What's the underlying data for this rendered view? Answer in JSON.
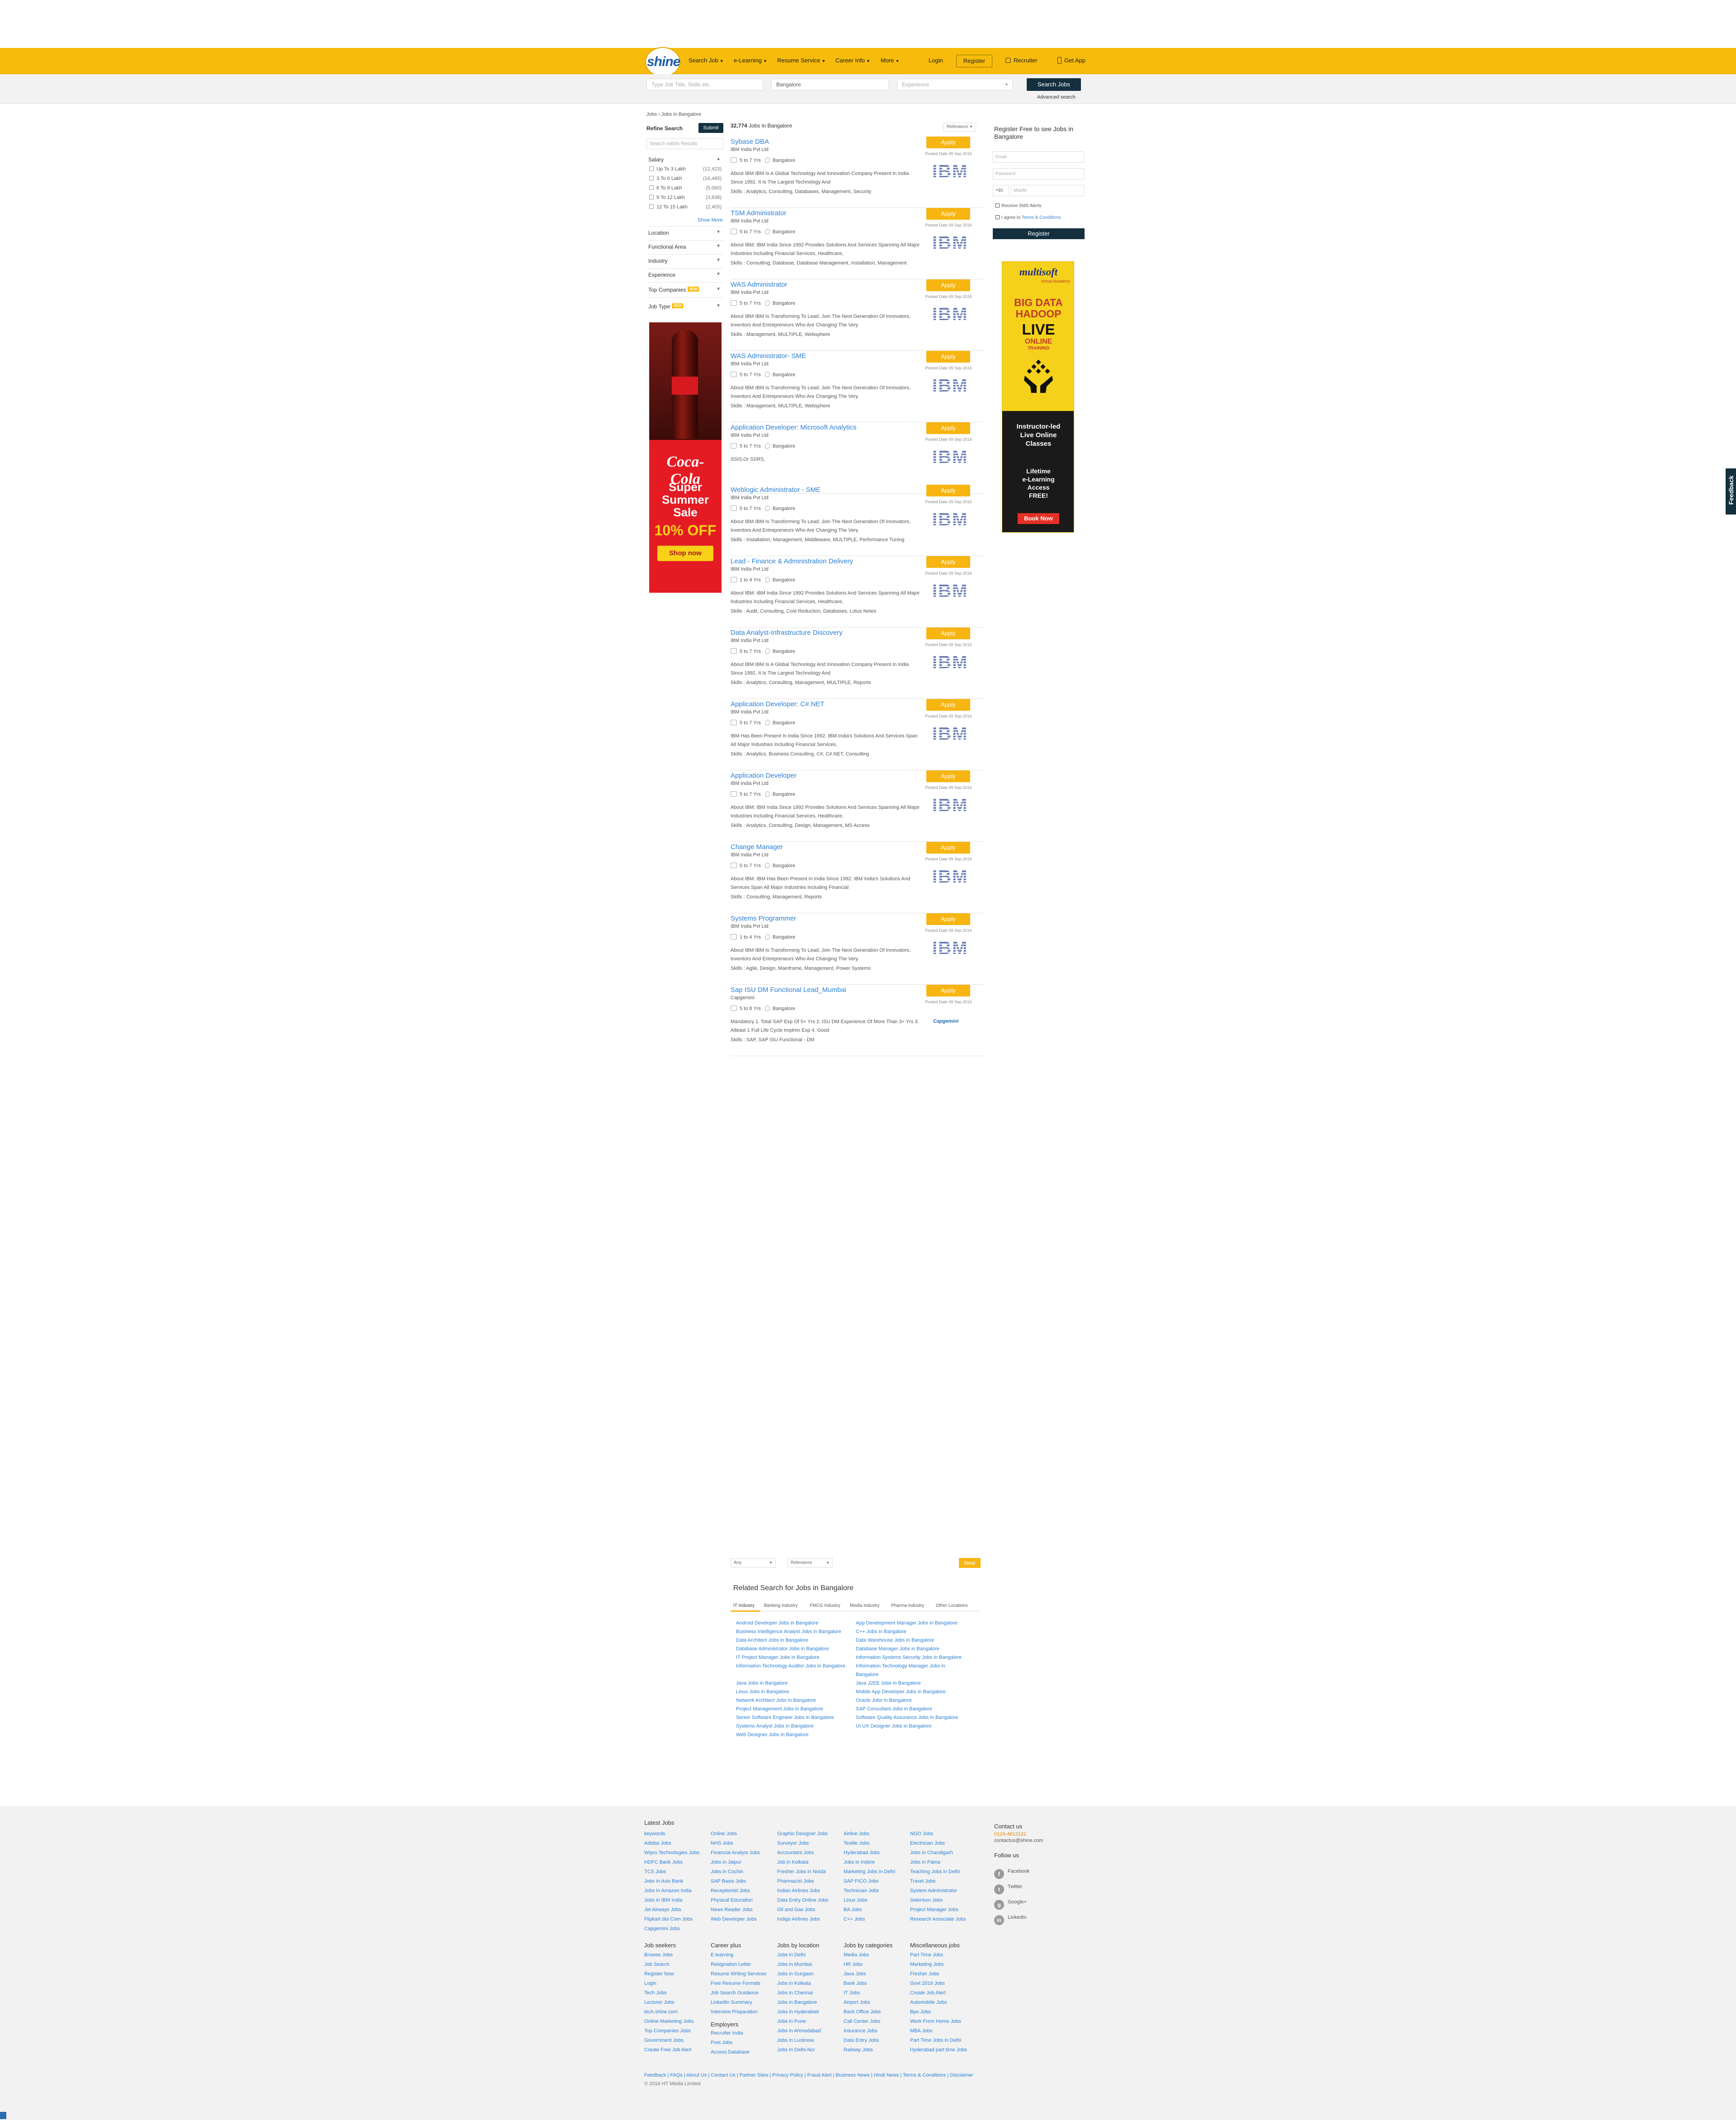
{
  "header": {
    "logo": "shine",
    "nav": [
      {
        "label": "Search Job",
        "caret": true
      },
      {
        "label": "e-Learning",
        "caret": true
      },
      {
        "label": "Resume Service",
        "caret": true
      },
      {
        "label": "Career Info",
        "caret": true
      },
      {
        "label": "More",
        "caret": true
      }
    ],
    "login": "Login",
    "register": "Register",
    "recruiter": "Recruiter",
    "get_app": "Get App"
  },
  "search": {
    "keyword_placeholder": "Type Job Title, Skills etc",
    "location_value": "Bangalore",
    "experience_placeholder": "Experience",
    "button": "Search Jobs",
    "advanced": "Advanced search"
  },
  "breadcrumb": "Jobs › Jobs in Bangalore",
  "refine": {
    "title": "Refine Search",
    "submit": "Submit",
    "within_placeholder": "Search within Results",
    "salary_label": "Salary",
    "salary_items": [
      {
        "label": "Up To 3 Lakh",
        "count": "(12,423)"
      },
      {
        "label": "3 To 6 Lakh",
        "count": "(16,465)"
      },
      {
        "label": "6 To 9 Lakh",
        "count": "(5,060)"
      },
      {
        "label": "9 To 12 Lakh",
        "count": "(3,838)"
      },
      {
        "label": "12 To 15 Lakh",
        "count": "(2,405)"
      }
    ],
    "show_more": "Show More",
    "facets": [
      "Location",
      "Functional Area",
      "Industry",
      "Experience",
      "Top Companies",
      "Job Type"
    ],
    "new_badge": "NEW"
  },
  "coke_ad": {
    "logo": "Coca-Cola",
    "line1": "Super",
    "line2": "Summer",
    "line3": "Sale",
    "offer": "10% OFF",
    "cta": "Shop now"
  },
  "results": {
    "count": "32,774",
    "count_suffix": "Jobs in Bangalore",
    "sort": "Relevance",
    "apply_label": "Apply",
    "skills_prefix": "Skills :",
    "jobs": [
      {
        "title": "Sybase DBA",
        "company": "IBM India Pvt Ltd",
        "exp": "5 to 7 Yrs",
        "loc": "Bangalore",
        "posted": "Posted Date 09 Sep 2016",
        "desc": "About IBM IBM Is A Global Technology And Innovation Company Present In India Since 1992. It Is The Largest Technology And",
        "skills": "Analytics, Consulting, Databases, Management, Security",
        "logo": "IBM"
      },
      {
        "title": "TSM Administrator",
        "company": "IBM India Pvt Ltd",
        "exp": "5 to 7 Yrs",
        "loc": "Bangalore",
        "posted": "Posted Date 09 Sep 2016",
        "desc": "About IBM: IBM India Since 1992 Provides Solutions And Services Spanning All Major Industries Including Financial Services, Healthcare,",
        "skills": "Consulting, Database, Database Management, Installation, Management",
        "logo": "IBM"
      },
      {
        "title": "WAS Administrator",
        "company": "IBM India Pvt Ltd",
        "exp": "5 to 7 Yrs",
        "loc": "Bangalore",
        "posted": "Posted Date 09 Sep 2016",
        "desc": "About IBM IBM Is Transforming To Lead. Join The Next Generation Of Innovators, Inventors And Entrepreneurs Who Are Changing The Very",
        "skills": "Management, MULTIPLE, Websphere",
        "logo": "IBM"
      },
      {
        "title": "WAS Administrator- SME",
        "company": "IBM India Pvt Ltd",
        "exp": "5 to 7 Yrs",
        "loc": "Bangalore",
        "posted": "Posted Date 09 Sep 2016",
        "desc": "About IBM IBM Is Transforming To Lead. Join The Next Generation Of Innovators, Inventors And Entrepreneurs Who Are Changing The Very",
        "skills": "Management, MULTIPLE, Websphere",
        "logo": "IBM"
      },
      {
        "title": "Application Developer: Microsoft Analytics",
        "company": "IBM India Pvt Ltd",
        "exp": "5 to 7 Yrs",
        "loc": "Bangalore",
        "posted": "Posted Date 09 Sep 2016",
        "desc": "SSIS,Or SSRS,",
        "skills": "",
        "logo": "IBM"
      },
      {
        "title": "Weblogic Administrator - SME",
        "company": "IBM India Pvt Ltd",
        "exp": "5 to 7 Yrs",
        "loc": "Bangalore",
        "posted": "Posted Date 09 Sep 2016",
        "desc": "About IBM IBM Is Transforming To Lead. Join The Next Generation Of Innovators, Inventors And Entrepreneurs Who Are Changing The Very",
        "skills": "Installation, Management, Middleware, MULTIPLE, Performance Tuning",
        "logo": "IBM"
      },
      {
        "title": "Lead - Finance & Administration Delivery",
        "company": "IBM India Pvt Ltd",
        "exp": "1 to 4 Yrs",
        "loc": "Bangalore",
        "posted": "Posted Date 09 Sep 2016",
        "desc": "About IBM: IBM India Since 1992 Provides Solutions And Services Spanning All Major Industries Including Financial Services, Healthcare,",
        "skills": "Audit, Consulting, Cost Reduction, Databases, Lotus Notes",
        "logo": "IBM"
      },
      {
        "title": "Data Analyst-Infrastructure Discovery",
        "company": "IBM India Pvt Ltd",
        "exp": "5 to 7 Yrs",
        "loc": "Bangalore",
        "posted": "Posted Date 09 Sep 2016",
        "desc": "About IBM IBM Is A Global Technology And Innovation Company Present In India Since 1992. It Is The Largest Technology And",
        "skills": "Analytics, Consulting, Management, MULTIPLE, Reports",
        "logo": "IBM"
      },
      {
        "title": "Application Developer: C#.NET",
        "company": "IBM India Pvt Ltd",
        "exp": "5 to 7 Yrs",
        "loc": "Bangalore",
        "posted": "Posted Date 09 Sep 2016",
        "desc": "IBM Has Been Present In India Since 1992. IBM India's Solutions And Services Span All Major Industries Including Financial Services,",
        "skills": "Analytics, Business Consulting, C#, C#.NET, Consulting",
        "logo": "IBM"
      },
      {
        "title": "Application Developer",
        "company": "IBM India Pvt Ltd",
        "exp": "5 to 7 Yrs",
        "loc": "Bangalore",
        "posted": "Posted Date 09 Sep 2016",
        "desc": "About IBM: IBM India Since 1992 Provides Solutions And Services Spanning All Major Industries Including Financial Services, Healthcare,",
        "skills": "Analytics, Consulting, Design, Management, MS Access",
        "logo": "IBM"
      },
      {
        "title": "Change Manager",
        "company": "IBM India Pvt Ltd",
        "exp": "5 to 7 Yrs",
        "loc": "Bangalore",
        "posted": "Posted Date 09 Sep 2016",
        "desc": "About IBM: IBM Has Been Present In India Since 1992. IBM India's Solutions And Services Span All Major Industries Including Financial",
        "skills": "Consulting, Management, Reports",
        "logo": "IBM"
      },
      {
        "title": "Systems Programmer",
        "company": "IBM India Pvt Ltd",
        "exp": "1 to 4 Yrs",
        "loc": "Bangalore",
        "posted": "Posted Date 09 Sep 2016",
        "desc": "About IBM IBM Is Transforming To Lead. Join The Next Generation Of Innovators, Inventors And Entrepreneurs Who Are Changing The Very",
        "skills": "Agile, Design, Mainframe, Management, Power Systems",
        "logo": "IBM"
      },
      {
        "title": "Sap ISU DM Functional Lead_Mumbai",
        "company": "Capgemini",
        "exp": "5 to 8 Yrs",
        "loc": "Bangalore",
        "posted": "Posted Date 09 Sep 2016",
        "desc": "Mandatory 1. Total SAP Exp Of 5+ Yrs 2. ISU DM Experience Of More Than 3+ Yrs 3. Atleast 1 Full Life Cycle Implmn Exp 4. Good",
        "skills": "SAP, SAP ISU Functional - DM",
        "logo": "Capgemini"
      }
    ]
  },
  "register_panel": {
    "title": "Register Free to see Jobs in Bangalore",
    "email_placeholder": "Email",
    "password_placeholder": "Password",
    "country_code": "+91",
    "mobile_placeholder": "Mobile",
    "sms_label": "Receive SMS Alerts",
    "agree_prefix": "I agree to",
    "terms_link": "Terms & Conditions",
    "button": "Register"
  },
  "multisoft_ad": {
    "brand": "multisoft",
    "tagline": "Virtual Academy",
    "big_data": "BIG DATA",
    "hadoop": "HADOOP",
    "live": "LIVE",
    "online": "ONLINE",
    "training": "TRAINING",
    "line_a": "Instructor-led",
    "line_b": "Live Online",
    "line_c": "Classes",
    "line_d": "Lifetime",
    "line_e": "e-Learning",
    "line_f": "Access",
    "line_g": "FREE!",
    "cta": "Book Now"
  },
  "feedback_tab": "Feedback",
  "pagination": {
    "page": "Any",
    "sort": "Relevance",
    "next": "Next"
  },
  "related": {
    "title": "Related Search for Jobs in Bangalore",
    "tabs": [
      "IT Industry",
      "Banking Industry",
      "FMCG Industry",
      "Media Industry",
      "Pharma Industry",
      "Other Locations"
    ],
    "left_links": [
      "Android Developer Jobs in Bangalore",
      "Business Intelligence Analyst Jobs in Bangalore",
      "Data Architect Jobs in Bangalore",
      "Database Administrator Jobs in Bangalore",
      "IT Project Manager Jobs in Bangalore",
      "Information Technology Auditor Jobs in Bangalore",
      "",
      "Java Jobs in Bangalore",
      "Linux Jobs in Bangalore",
      "Network Architect Jobs in Bangalore",
      "Project Management Jobs in Bangalore",
      "Senior Software Engineer Jobs in Bangalore",
      "Systems Analyst Jobs in Bangalore",
      "Web Designer Jobs in Bangalore"
    ],
    "right_links": [
      "App Development Manager Jobs in Bangalore",
      "C++ Jobs in Bangalore",
      "Data Warehouse Jobs in Bangalore",
      "Database Manager Jobs in Bangalore",
      "Information Systems Security Jobs in Bangalore",
      "Information Technology Manager Jobs in",
      "Bangalore",
      "Java J2EE Jobs in Bangalore",
      "Mobile App Developer Jobs in Bangalore",
      "Oracle Jobs in Bangalore",
      "SAP Consultant Jobs in Bangalore",
      "Software Quality Assurance Jobs in Bangalore",
      "UI UX Designer Jobs in Bangalore",
      ""
    ]
  },
  "footer": {
    "latest_jobs": {
      "title": "Latest Jobs",
      "col1": [
        "keywords",
        "Adidas Jobs",
        "Wipro Technologies Jobs",
        "HDFC Bank Jobs",
        "TCS Jobs",
        "Jobs in Axis Bank",
        "Jobs in Amazon India",
        "Jobs in IBM India",
        "Jet Airways Jobs",
        "Flipkart dot Com Jobs",
        "Capgemini Jobs"
      ],
      "col2": [
        "Online Jobs",
        "NHS Jobs",
        "Financial Analyst Jobs",
        "Jobs in Jaipur",
        "Jobs in Cochin",
        "SAP Basis Jobs",
        "Receptionist Jobs",
        "Physical Education",
        "News Reader Jobs",
        "Web Developer Jobs"
      ],
      "col3": [
        "Graphic Designer Jobs",
        "Surveyor Jobs",
        "Accountant Jobs",
        "Job in Kolkata",
        "Fresher Jobs in Noida",
        "Pharmacist Jobs",
        "Indian Airlines Jobs",
        "Data Entry Online Jobs",
        "Oil and Gas Jobs",
        "Indigo Airlines Jobs"
      ],
      "col4": [
        "Airline Jobs",
        "Textile Jobs",
        "Hyderabad Jobs",
        "Jobs in Indore",
        "Marketing Jobs in Delhi",
        "SAP FICO Jobs",
        "Technician Jobs",
        "Linux Jobs",
        "BA Jobs",
        "C++ Jobs"
      ],
      "col5": [
        "NGO Jobs",
        "Electrician Jobs",
        "Jobs in Chandigarh",
        "Jobs in Patna",
        "Teaching Jobs in Delhi",
        "Travel Jobs",
        "System Administrator",
        "Selenium Jobs",
        "Project Manager Jobs",
        "Research Associate Jobs"
      ]
    },
    "contact": {
      "title": "Contact us",
      "phone": "0124-4613131",
      "email": "contactus@shine.com",
      "follow": "Follow us",
      "social": [
        "Facebook",
        "Twitter",
        "Google+",
        "LinkedIn"
      ]
    },
    "job_seekers": {
      "title": "Job seekers",
      "links": [
        "Browse Jobs",
        "Job Search",
        "Register Now",
        "Login",
        "Tech Jobs",
        "Lecturer Jobs",
        "tech.shine.com",
        "Online Marketing Jobs",
        "Top Companies Jobs",
        "Government Jobs",
        "Create Free Job Alert"
      ]
    },
    "career_plus": {
      "title": "Career plus",
      "links": [
        "E-learning",
        "Resignation Letter",
        "Resume Writing Services",
        "Free Resume Formats",
        "Job Search Guidance",
        "LinkedIn Summary",
        "Interview Preparation"
      ],
      "employers_title": "Employers",
      "employers": [
        "Recruiter India",
        "Post Jobs",
        "Access Database"
      ]
    },
    "by_location": {
      "title": "Jobs by location",
      "links": [
        "Jobs in Delhi",
        "Jobs in Mumbai",
        "Jobs in Gurgaon",
        "Jobs in Kolkata",
        "Jobs in Chennai",
        "Jobs in Bangalore",
        "Jobs in Hyderabad",
        "Jobs in Pune",
        "Jobs in Ahmedabad",
        "Jobs in Lucknow",
        "Jobs in Delhi-Ncr"
      ]
    },
    "by_category": {
      "title": "Jobs by categories",
      "links": [
        "Media Jobs",
        "HR Jobs",
        "Java Jobs",
        "Bank Jobs",
        "IT Jobs",
        "Airport Jobs",
        "Back Office Jobs",
        "Call Center Jobs",
        "Insurance Jobs",
        "Data Entry Jobs",
        "Railway Jobs"
      ]
    },
    "misc": {
      "title": "Miscellaneous jobs",
      "links": [
        "Part Time Jobs",
        "Marketing Jobs",
        "Fresher Jobs",
        "Govt 2016 Jobs",
        "Create Job Alert",
        "Automobile Jobs",
        "Bpo Jobs",
        "Work From Home Jobs",
        "MBA Jobs",
        "Part Time Jobs in Delhi",
        "Hyderabad part time Jobs"
      ]
    },
    "bottom_links": "Feedback  |  FAQs  |  About Us  |  Contact Us  |  Partner Sites  |  Privacy Policy  |  Fraud Alert  |  Business News  |  Hindi News  |  Terms & Conditions  |  Disclaimer",
    "copyright": "© 2016 HT Media Limited"
  }
}
